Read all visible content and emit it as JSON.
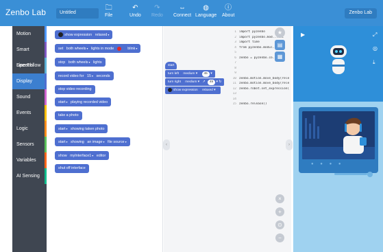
{
  "app": {
    "brand": "Zenbo Lab",
    "project_title": "Untitled",
    "user_button": "Zenbo Lab"
  },
  "menu": [
    {
      "label": "File",
      "icon": "folder-icon",
      "glyph": "🗀",
      "disabled": false
    },
    {
      "label": "Undo",
      "icon": "undo-icon",
      "glyph": "↶",
      "disabled": false
    },
    {
      "label": "Redo",
      "icon": "redo-icon",
      "glyph": "↷",
      "disabled": true
    },
    {
      "label": "Connect",
      "icon": "link-icon",
      "glyph": "⇔",
      "disabled": false
    },
    {
      "label": "Language",
      "icon": "globe-icon",
      "glyph": "◍",
      "disabled": false
    },
    {
      "label": "About",
      "icon": "info-icon",
      "glyph": "ⓘ",
      "disabled": false
    }
  ],
  "categories": [
    {
      "label": "Motion",
      "color": "#4c97ff"
    },
    {
      "label": "Smart Speech",
      "color": "#7e57c2"
    },
    {
      "label": "Line Follow",
      "color": "#5cb1d6"
    },
    {
      "label": "Display",
      "color": "#4e6fd0",
      "active": true
    },
    {
      "label": "Sound",
      "color": "#cf63cf"
    },
    {
      "label": "Events",
      "color": "#ffbf00"
    },
    {
      "label": "Logic",
      "color": "#ff8c1a"
    },
    {
      "label": "Sensors",
      "color": "#59c059"
    },
    {
      "label": "Variables",
      "color": "#ff661a"
    },
    {
      "label": "AI Sensing",
      "color": "#0fbd8c"
    }
  ],
  "palette": {
    "show_expression": {
      "text": "show expression",
      "value": "relaxed"
    },
    "set_wheels": {
      "text1": "set",
      "target": "both wheels",
      "text2": "lights in mode",
      "mode": "blink"
    },
    "stop_wheels": {
      "text1": "stop",
      "target": "both wheels",
      "text2": "lights"
    },
    "record_video": {
      "text1": "record video for",
      "value": "15",
      "text2": "seconds"
    },
    "stop_recording": {
      "text": "stop video recording"
    },
    "start_playing": {
      "action": "start",
      "text": "playing recorded video"
    },
    "take_photo": {
      "text": "take a photo"
    },
    "start_showing_photo": {
      "action": "start",
      "text": "showing taken photo"
    },
    "start_showing_image": {
      "action": "start",
      "text1": "showing",
      "image": "an image",
      "source": "file source"
    },
    "show_interface": {
      "text1": "show",
      "name": "myInterface1",
      "text2": "editor"
    },
    "shut_off": {
      "text": "shut off interface"
    }
  },
  "workspace": {
    "hat": "start",
    "turn_left": {
      "text": "turn left",
      "speed": "medium",
      "angle": "45"
    },
    "turn_right": {
      "text": "turn right",
      "speed": "medium",
      "angle": "45"
    },
    "show_expression": {
      "text": "show expression",
      "value": "relaxed"
    }
  },
  "code_lines": [
    {
      "n": "1",
      "t": "import pyzenbo"
    },
    {
      "n": "2",
      "t": "import pyzenbo.mod...ent"
    },
    {
      "n": "3",
      "t": "import time"
    },
    {
      "n": "4",
      "t": "from pyzenbo.modul...ing"
    },
    {
      "n": "5",
      "t": ""
    },
    {
      "n": "6",
      "t": "zenbo = pyzenbo.co...\")"
    },
    {
      "n": "7",
      "t": ""
    },
    {
      "n": "8",
      "t": ""
    },
    {
      "n": "9",
      "t": ""
    },
    {
      "n": "10",
      "t": "zenbo.motion.move_body(rele"
    },
    {
      "n": "11",
      "t": "zenbo.motion.move_body(rele"
    },
    {
      "n": "12",
      "t": "zenbo.robot.set_expression("
    },
    {
      "n": "13",
      "t": ""
    },
    {
      "n": "14",
      "t": ""
    },
    {
      "n": "15",
      "t": "zenbo.release()"
    }
  ],
  "colors": {
    "topbar": "#3a8fd6",
    "display_block": "#4e6fd0",
    "rail": "#3f4651",
    "preview_bg": "#9fd2f0"
  }
}
